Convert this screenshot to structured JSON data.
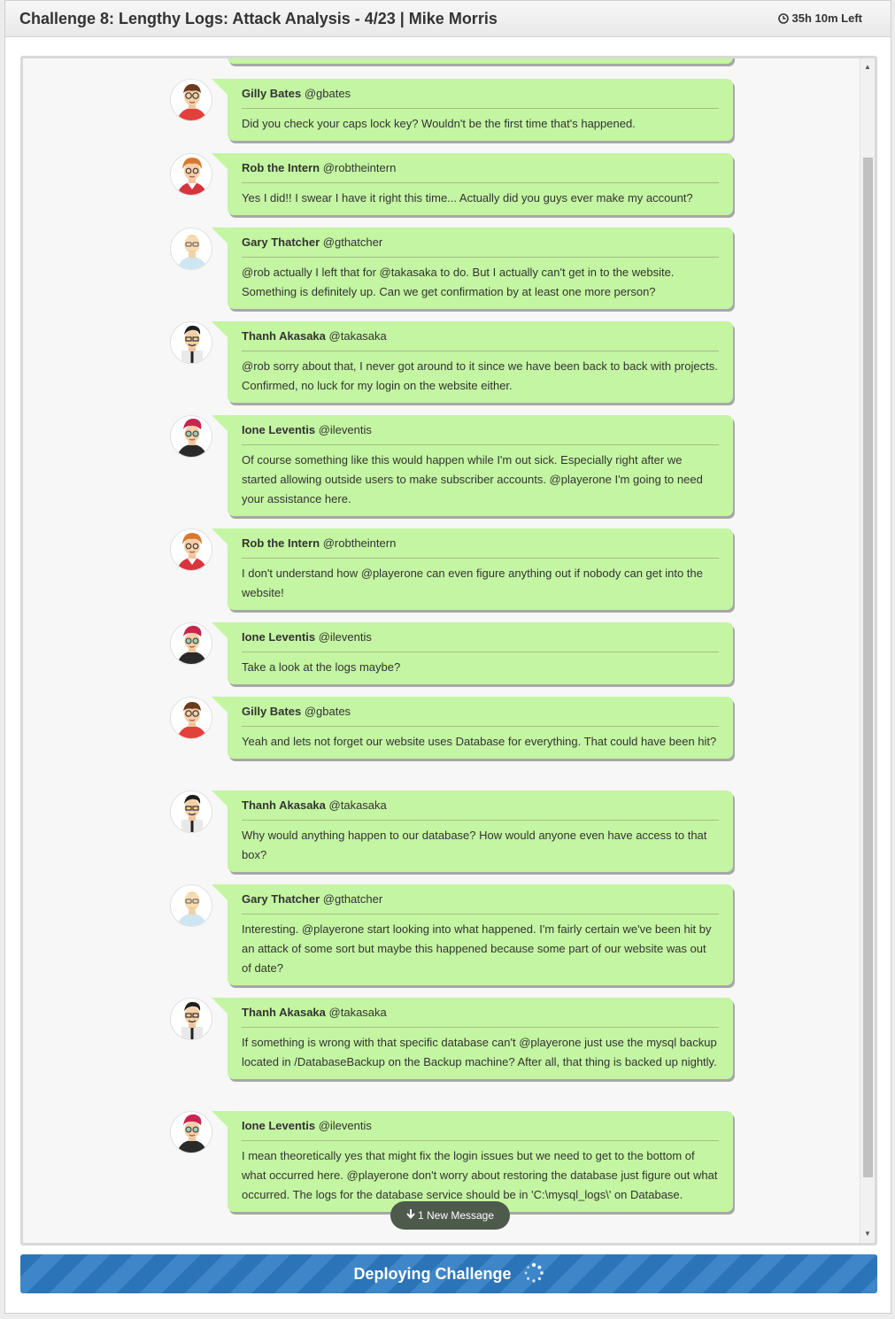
{
  "header": {
    "title": "Challenge 8: Lengthy Logs: Attack Analysis - 4/23 | Mike Morris",
    "time_left": "35h 10m Left",
    "clock_icon": "clock-icon"
  },
  "chat": {
    "messages": [
      {
        "name": "Gilly Bates",
        "handle": "@gbates",
        "text": "Did you check your caps lock key? Wouldn't be the first time that's happened.",
        "avatar": "gilly"
      },
      {
        "name": "Rob the Intern",
        "handle": "@robtheintern",
        "text": "Yes I did!! I swear I have it right this time... Actually did you guys ever make my account?",
        "avatar": "rob"
      },
      {
        "name": "Gary Thatcher",
        "handle": "@gthatcher",
        "text": "@rob actually I left that for @takasaka to do. But I actually can't get in to the website. Something is definitely up. Can we get confirmation by at least one more person?",
        "avatar": "gary"
      },
      {
        "name": "Thanh Akasaka",
        "handle": "@takasaka",
        "text": "@rob sorry about that, I never got around to it since we have been back to back with projects. Confirmed, no luck for my login on the website either.",
        "avatar": "thanh"
      },
      {
        "name": "Ione Leventis",
        "handle": "@ileventis",
        "text": "Of course something like this would happen while I'm out sick. Especially right after we started allowing outside users to make subscriber accounts. @playerone I'm going to need your assistance here.",
        "avatar": "ione"
      },
      {
        "name": "Rob the Intern",
        "handle": "@robtheintern",
        "text": "I don't understand how @playerone can even figure anything out if nobody can get into the website!",
        "avatar": "rob"
      },
      {
        "name": "Ione Leventis",
        "handle": "@ileventis",
        "text": "Take a look at the logs maybe?",
        "avatar": "ione"
      },
      {
        "name": "Gilly Bates",
        "handle": "@gbates",
        "text": "Yeah and lets not forget our website uses Database for everything. That could have been hit?",
        "avatar": "gilly"
      },
      {
        "name": "Thanh Akasaka",
        "handle": "@takasaka",
        "text": "Why would anything happen to our database? How would anyone even have access to that box?",
        "avatar": "thanh"
      },
      {
        "name": "Gary Thatcher",
        "handle": "@gthatcher",
        "text": "Interesting. @playerone start looking into what happened. I'm fairly certain we've been hit by an attack of some sort but maybe this happened because some part of our website was out of date?",
        "avatar": "gary"
      },
      {
        "name": "Thanh Akasaka",
        "handle": "@takasaka",
        "text": "If something is wrong with that specific database can't @playerone just use the mysql backup located in /DatabaseBackup on the Backup machine? After all, that thing is backed up nightly.",
        "avatar": "thanh"
      },
      {
        "name": "Ione Leventis",
        "handle": "@ileventis",
        "text": "I mean theoretically yes that might fix the login issues but we need to get to the bottom of what occurred here. @playerone don't worry about restoring the database just figure out what occurred. The logs for the database service should be in 'C:\\mysql_logs\\' on Database.",
        "avatar": "ione"
      }
    ],
    "new_message_label": "1 New Message"
  },
  "footer": {
    "deploy_label": "Deploying Challenge",
    "spinner_icon": "spinner-icon"
  },
  "colors": {
    "bubble": "#c4f5a2",
    "deploy_bar": "#2c74b8",
    "new_message_pill": "#4e5a4c"
  }
}
